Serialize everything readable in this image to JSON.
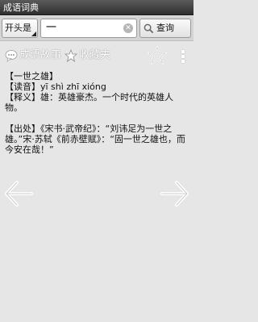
{
  "app": {
    "title": "成语词典"
  },
  "search": {
    "mode": "开头是",
    "value": "一",
    "clear_symbol": "✕",
    "button": "查询"
  },
  "toolbar": {
    "story": "成语故事",
    "favorites": "收藏夹"
  },
  "entry": {
    "word_line": "【一世之雄】",
    "pinyin_line": "【读音】yī shì zhī xióng",
    "meaning_line": "【释义】雄：英雄豪杰。一个时代的英雄人物。",
    "source_line": "【出处】《宋书·武帝纪》：“刘讳足为一世之雄。”宋·苏轼《前赤壁赋》：“固一世之雄也，而今安在哉！”"
  },
  "colors": {
    "background": "#e6e6e6",
    "titlebar": "#3a3a3a",
    "link_text": "#1f5fa8"
  }
}
